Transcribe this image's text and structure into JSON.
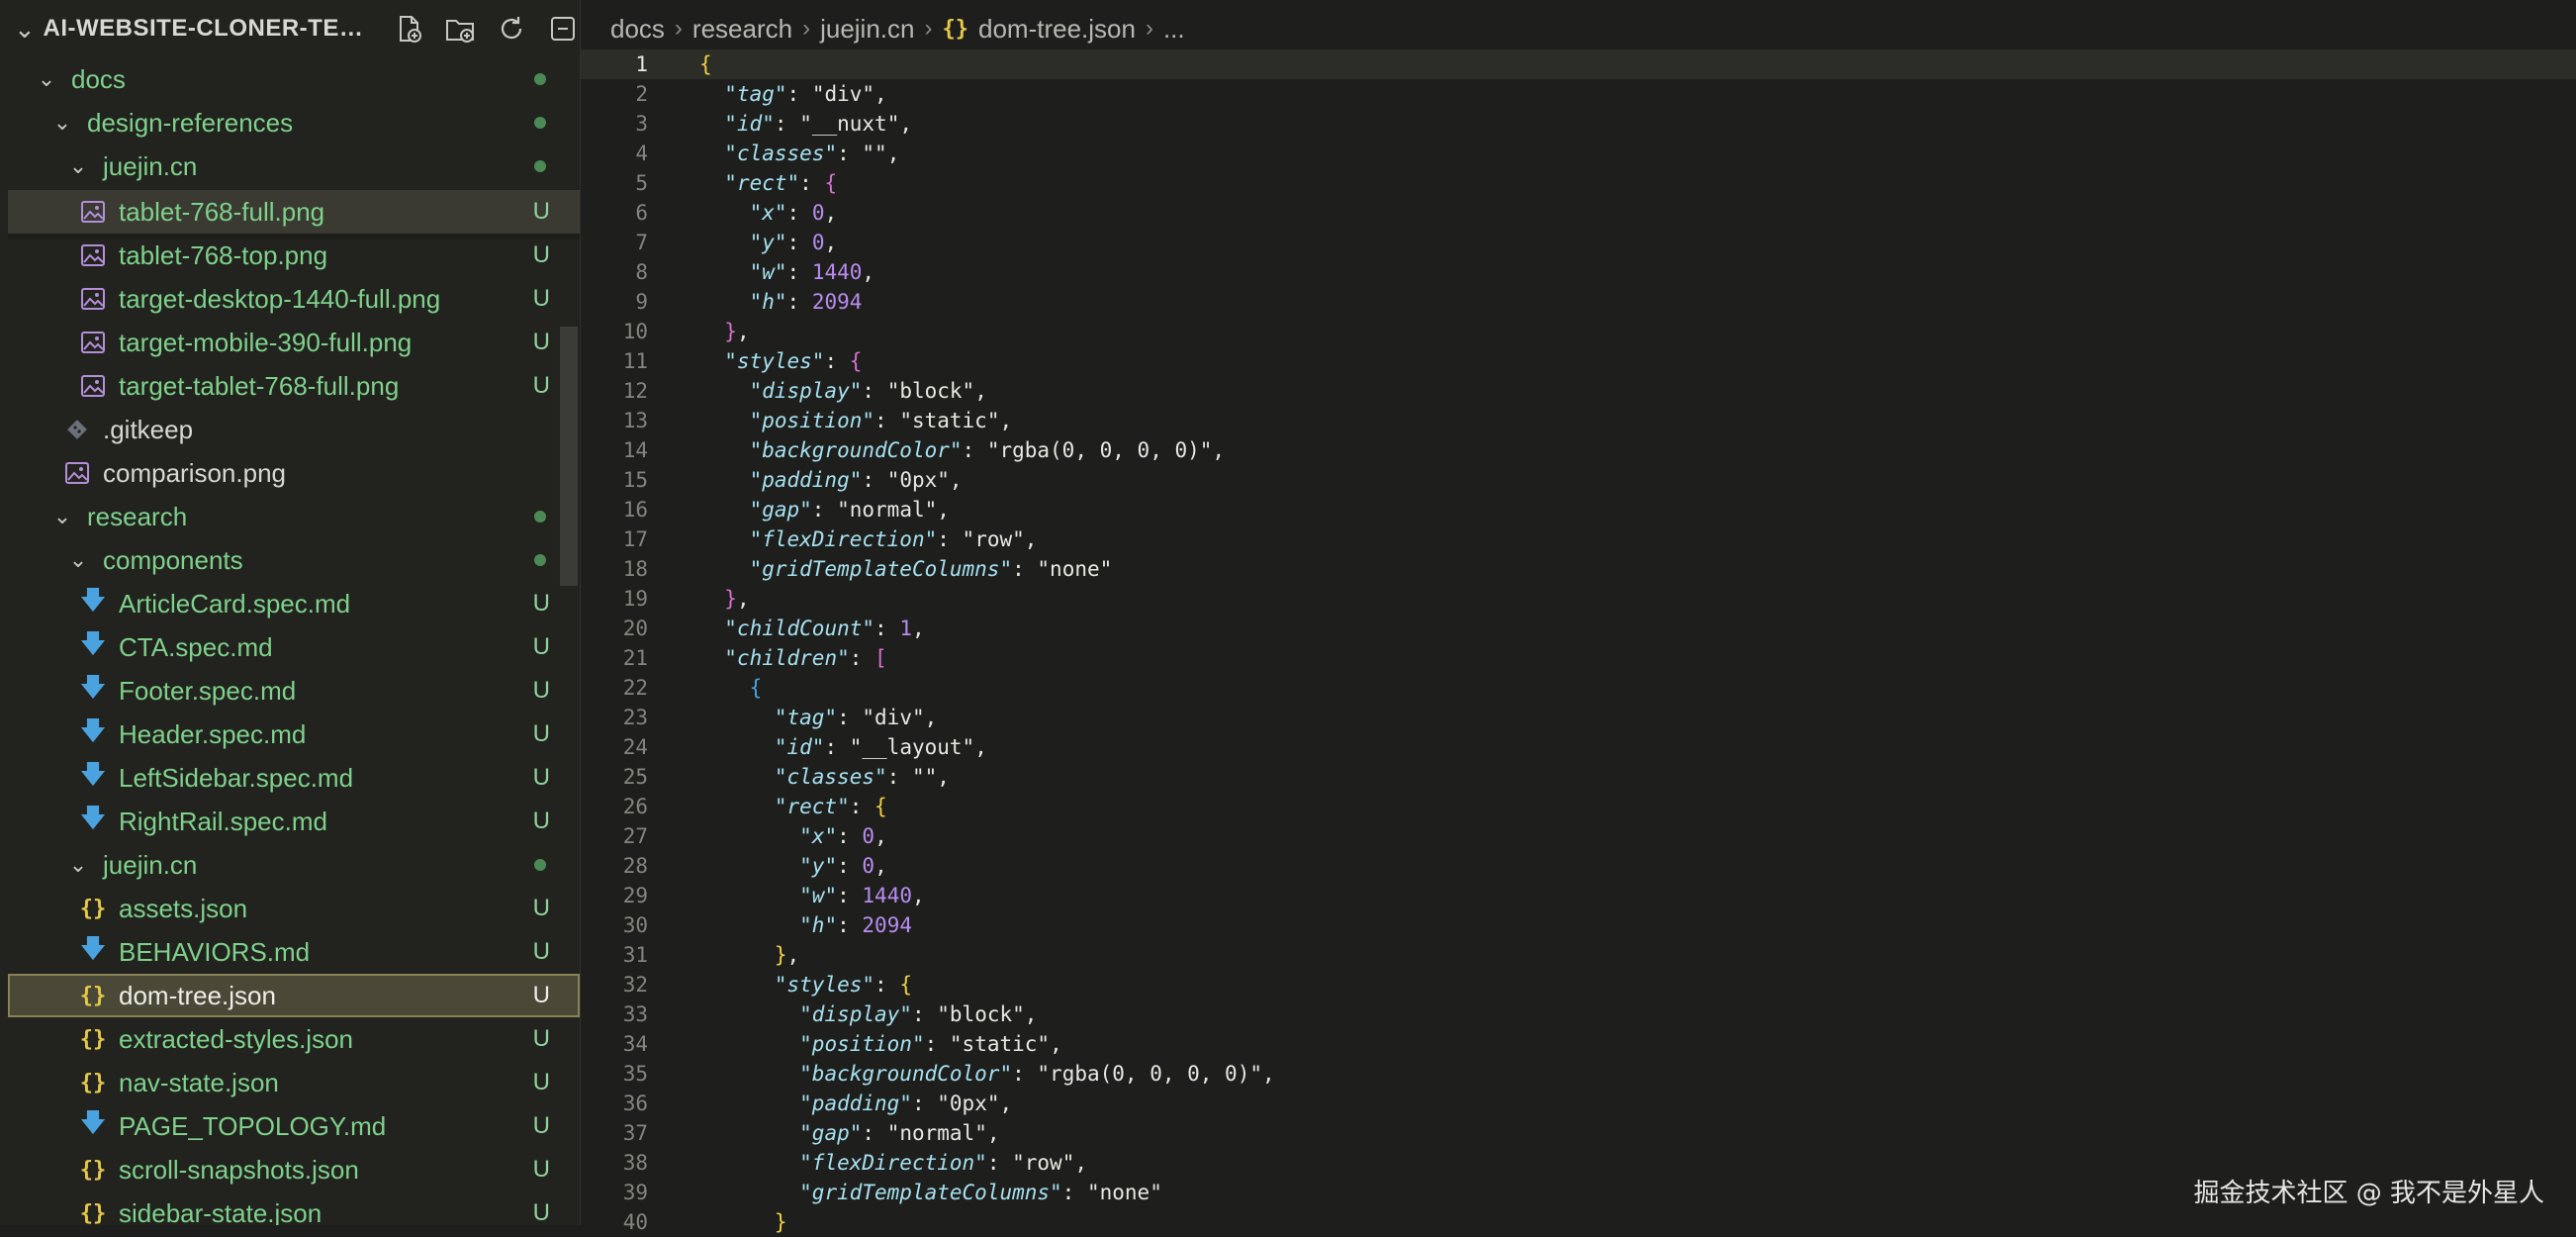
{
  "sidebar": {
    "title": "AI-WEBSITE-CLONER-TEM...",
    "rows": [
      {
        "label": "docs",
        "kind": "folder",
        "status": "dot"
      },
      {
        "label": "design-references",
        "kind": "folder",
        "status": "dot"
      },
      {
        "label": "juejin.cn",
        "kind": "folder",
        "status": "dot"
      },
      {
        "label": "tablet-768-full.png",
        "kind": "image",
        "status": "U"
      },
      {
        "label": "tablet-768-top.png",
        "kind": "image",
        "status": "U"
      },
      {
        "label": "target-desktop-1440-full.png",
        "kind": "image",
        "status": "U"
      },
      {
        "label": "target-mobile-390-full.png",
        "kind": "image",
        "status": "U"
      },
      {
        "label": "target-tablet-768-full.png",
        "kind": "image",
        "status": "U"
      },
      {
        "label": ".gitkeep",
        "kind": "git",
        "status": ""
      },
      {
        "label": "comparison.png",
        "kind": "image",
        "status": ""
      },
      {
        "label": "research",
        "kind": "folder",
        "status": "dot"
      },
      {
        "label": "components",
        "kind": "folder",
        "status": "dot"
      },
      {
        "label": "ArticleCard.spec.md",
        "kind": "md",
        "status": "U"
      },
      {
        "label": "CTA.spec.md",
        "kind": "md",
        "status": "U"
      },
      {
        "label": "Footer.spec.md",
        "kind": "md",
        "status": "U"
      },
      {
        "label": "Header.spec.md",
        "kind": "md",
        "status": "U"
      },
      {
        "label": "LeftSidebar.spec.md",
        "kind": "md",
        "status": "U"
      },
      {
        "label": "RightRail.spec.md",
        "kind": "md",
        "status": "U"
      },
      {
        "label": "juejin.cn",
        "kind": "folder",
        "status": "dot"
      },
      {
        "label": "assets.json",
        "kind": "json",
        "status": "U"
      },
      {
        "label": "BEHAVIORS.md",
        "kind": "md",
        "status": "U"
      },
      {
        "label": "dom-tree.json",
        "kind": "json",
        "status": "U"
      },
      {
        "label": "extracted-styles.json",
        "kind": "json",
        "status": "U"
      },
      {
        "label": "nav-state.json",
        "kind": "json",
        "status": "U"
      },
      {
        "label": "PAGE_TOPOLOGY.md",
        "kind": "md",
        "status": "U"
      },
      {
        "label": "scroll-snapshots.json",
        "kind": "json",
        "status": "U"
      },
      {
        "label": "sidebar-state.json",
        "kind": "json",
        "status": "U"
      }
    ]
  },
  "breadcrumb": {
    "items": [
      "docs",
      "research",
      "juejin.cn",
      "dom-tree.json",
      "..."
    ]
  },
  "code_lines": [
    "{",
    "  \"tag\": \"div\",",
    "  \"id\": \"__nuxt\",",
    "  \"classes\": \"\",",
    "  \"rect\": {",
    "    \"x\": 0,",
    "    \"y\": 0,",
    "    \"w\": 1440,",
    "    \"h\": 2094",
    "  },",
    "  \"styles\": {",
    "    \"display\": \"block\",",
    "    \"position\": \"static\",",
    "    \"backgroundColor\": \"rgba(0, 0, 0, 0)\",",
    "    \"padding\": \"0px\",",
    "    \"gap\": \"normal\",",
    "    \"flexDirection\": \"row\",",
    "    \"gridTemplateColumns\": \"none\"",
    "  },",
    "  \"childCount\": 1,",
    "  \"children\": [",
    "    {",
    "      \"tag\": \"div\",",
    "      \"id\": \"__layout\",",
    "      \"classes\": \"\",",
    "      \"rect\": {",
    "        \"x\": 0,",
    "        \"y\": 0,",
    "        \"w\": 1440,",
    "        \"h\": 2094",
    "      },",
    "      \"styles\": {",
    "        \"display\": \"block\",",
    "        \"position\": \"static\",",
    "        \"backgroundColor\": \"rgba(0, 0, 0, 0)\",",
    "        \"padding\": \"0px\",",
    "        \"gap\": \"normal\",",
    "        \"flexDirection\": \"row\",",
    "        \"gridTemplateColumns\": \"none\"",
    "      }"
  ],
  "watermark": "掘金技术社区 @ 我不是外星人"
}
